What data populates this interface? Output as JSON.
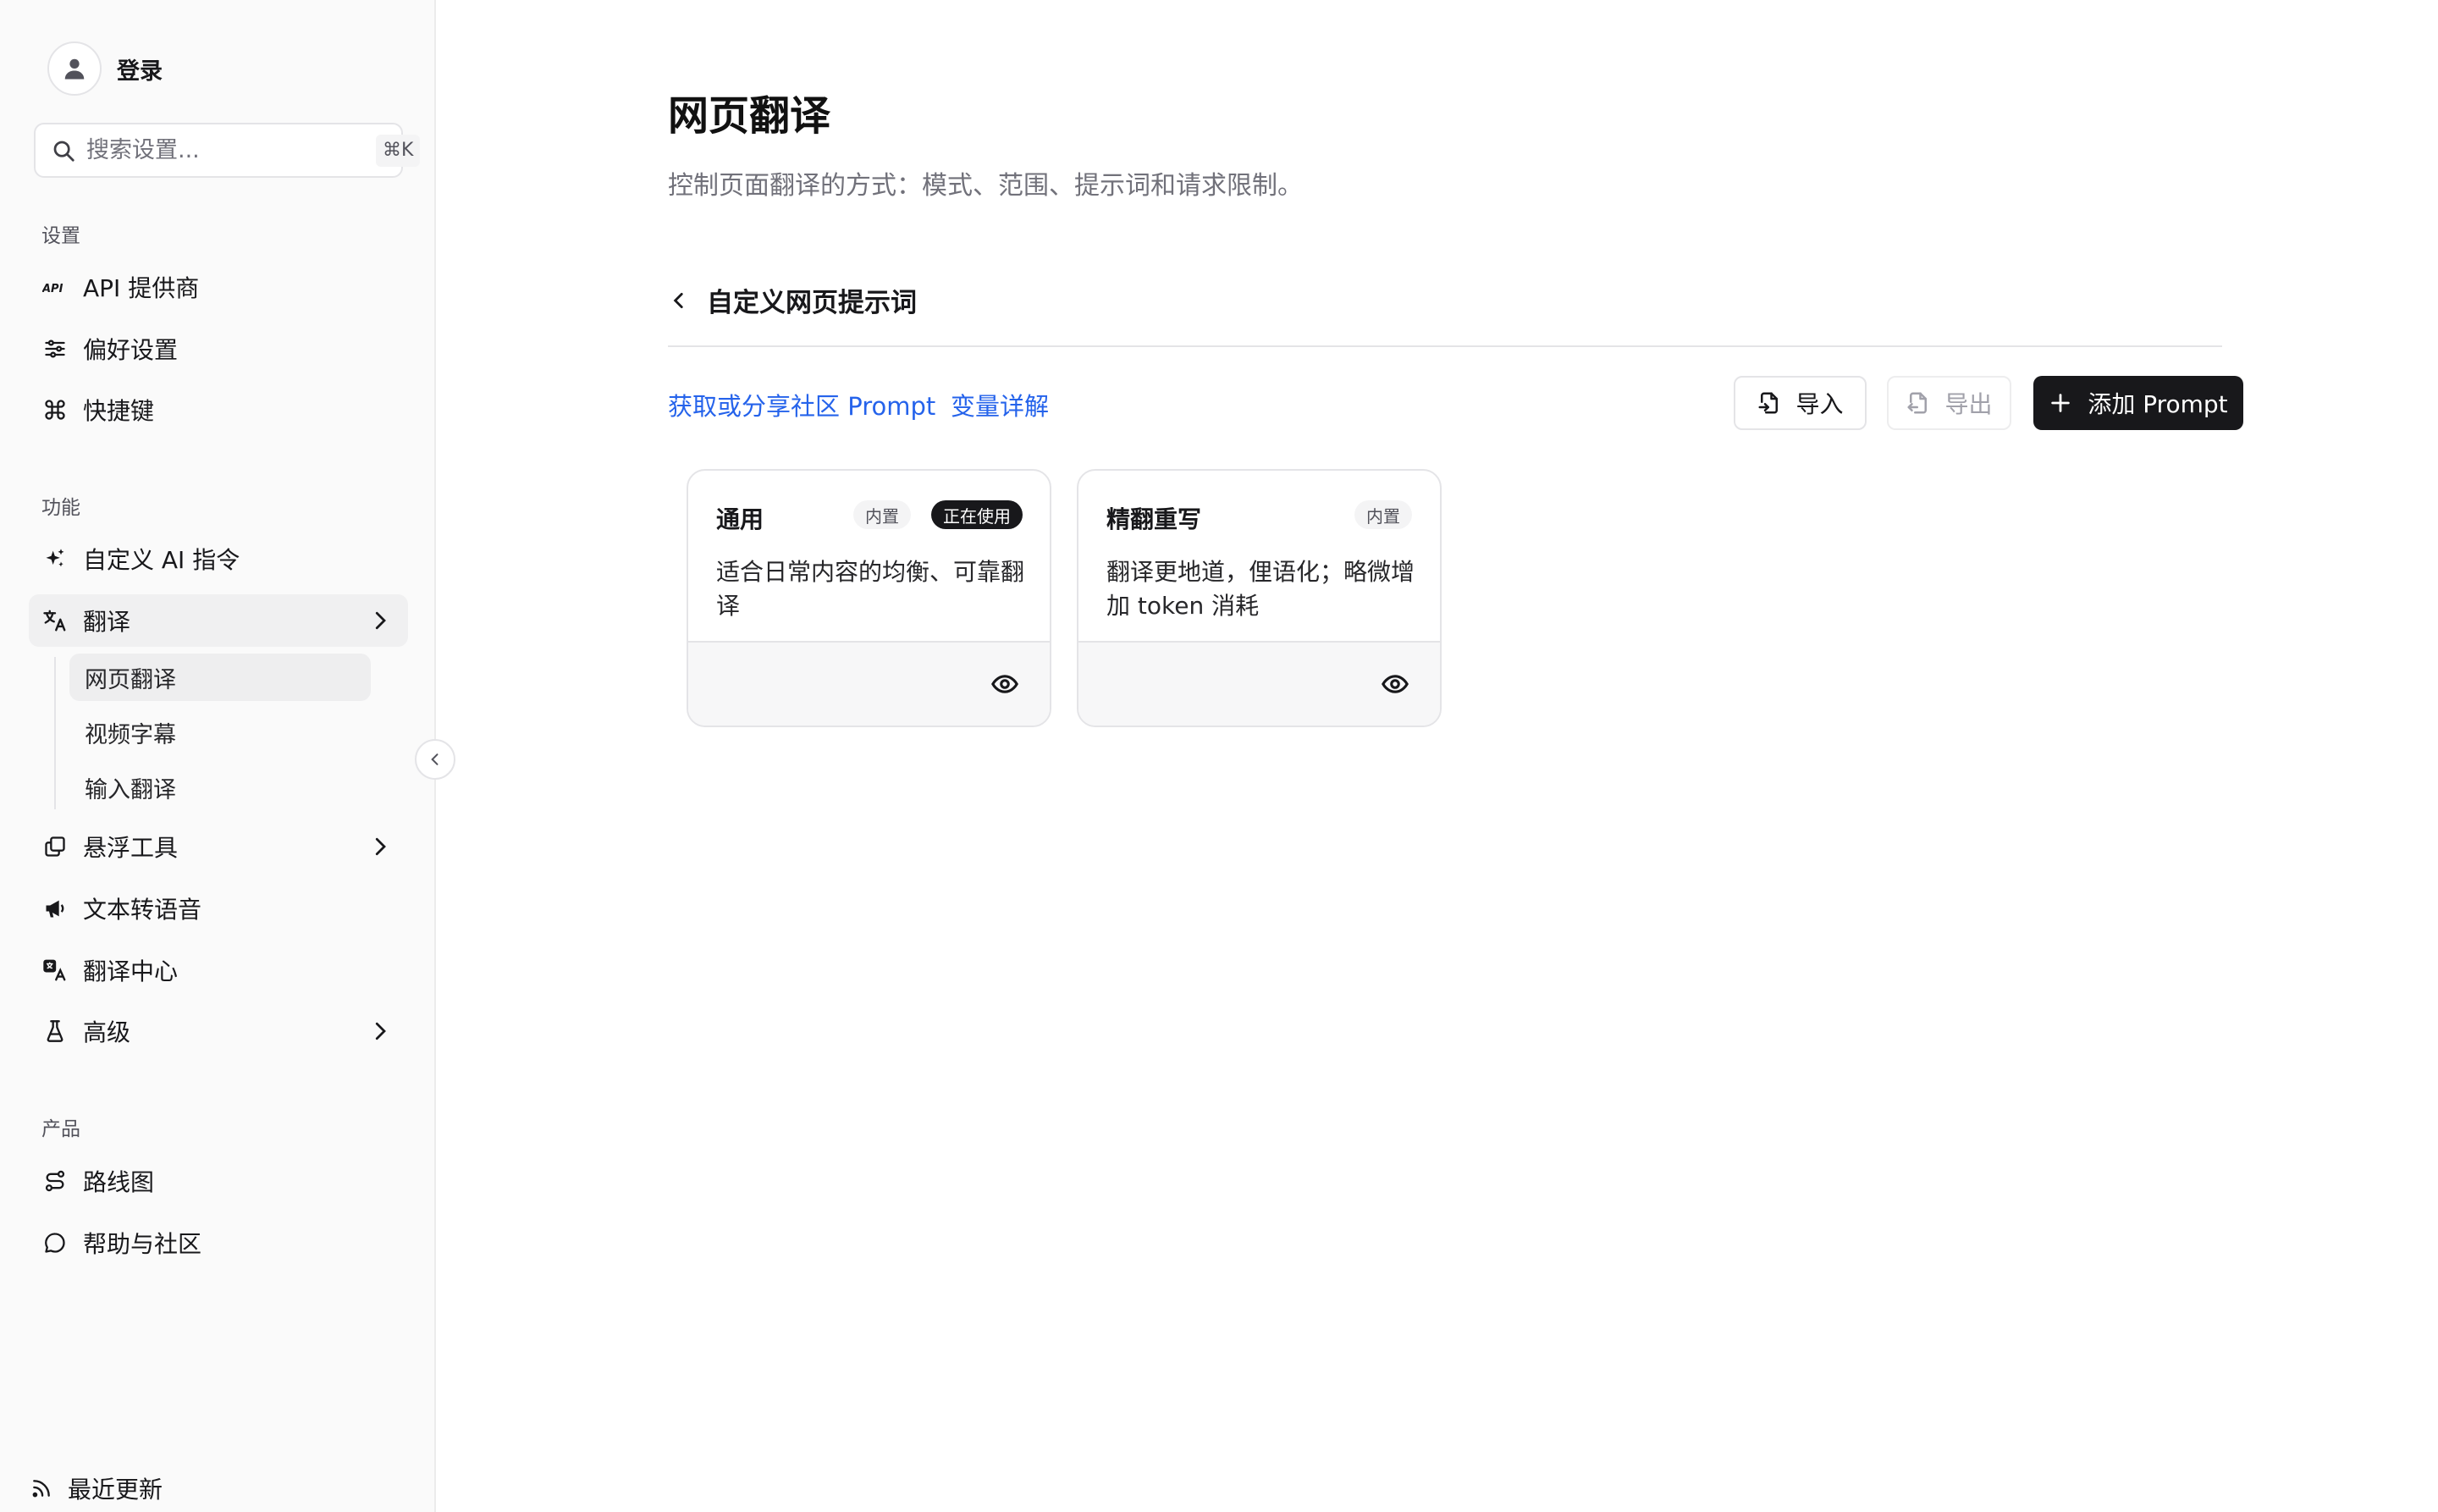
{
  "sidebar": {
    "login_label": "登录",
    "search": {
      "placeholder": "搜索设置...",
      "value": "",
      "shortcut": "⌘K"
    },
    "sections": {
      "settings": "设置",
      "features": "功能",
      "product": "产品"
    },
    "settings_items": [
      {
        "label": "API 提供商",
        "icon": "api-icon"
      },
      {
        "label": "偏好设置",
        "icon": "sliders-icon"
      },
      {
        "label": "快捷键",
        "icon": "command-icon"
      }
    ],
    "feature_items": [
      {
        "label": "自定义 AI 指令",
        "icon": "sparkles-icon"
      },
      {
        "label": "翻译",
        "icon": "translate-icon",
        "expanded": true
      },
      {
        "label": "悬浮工具",
        "icon": "layers-icon"
      },
      {
        "label": "文本转语音",
        "icon": "megaphone-icon"
      },
      {
        "label": "翻译中心",
        "icon": "translate-hub-icon"
      },
      {
        "label": "高级",
        "icon": "flask-icon"
      }
    ],
    "translate_sub_items": [
      {
        "label": "网页翻译",
        "active": true
      },
      {
        "label": "视频字幕"
      },
      {
        "label": "输入翻译"
      }
    ],
    "product_items": [
      {
        "label": "路线图",
        "icon": "route-icon"
      },
      {
        "label": "帮助与社区",
        "icon": "chat-bubble-icon"
      }
    ],
    "recent_updates": "最近更新"
  },
  "main": {
    "title": "网页翻译",
    "description": "控制页面翻译的方式：模式、范围、提示词和请求限制。",
    "subpage_title": "自定义网页提示词",
    "links": {
      "community": "获取或分享社区 Prompt",
      "variables": "变量详解"
    },
    "buttons": {
      "import": "导入",
      "export": "导出",
      "add": "添加 Prompt"
    },
    "cards": [
      {
        "title": "通用",
        "builtin_badge": "内置",
        "active_badge": "正在使用",
        "description": "适合日常内容的均衡、可靠翻译"
      },
      {
        "title": "精翻重写",
        "builtin_badge": "内置",
        "description": "翻译更地道，俚语化；略微增加 token 消耗"
      }
    ]
  },
  "colors": {
    "link": "#2563eb",
    "primary": "#18181b",
    "sidebar_bg": "#fafafa"
  }
}
